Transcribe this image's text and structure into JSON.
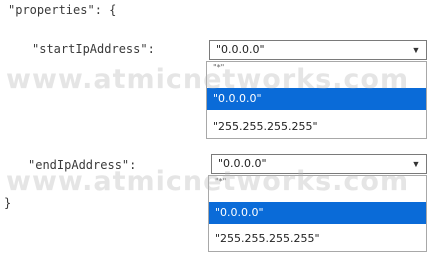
{
  "code": {
    "open_line": "\"properties\": {",
    "start_label": "\"startIpAddress\":",
    "end_label": "\"endIpAddress\":",
    "close_line": "}"
  },
  "watermark": "www.atmicnetworks.com",
  "start_dropdown": {
    "value": "\"0.0.0.0\"",
    "options": [
      "\"*\"",
      "\"0.0.0.0\"",
      "\"255.255.255.255\""
    ],
    "selected_index": 1
  },
  "end_dropdown": {
    "value": "\"0.0.0.0\"",
    "options": [
      "\"*\"",
      "\"0.0.0.0\"",
      "\"255.255.255.255\""
    ],
    "selected_index": 1
  },
  "colors": {
    "highlight": "#0a6bd8",
    "border": "#7a7a7a"
  },
  "icons": {
    "dropdown": "triangle-down-icon"
  }
}
